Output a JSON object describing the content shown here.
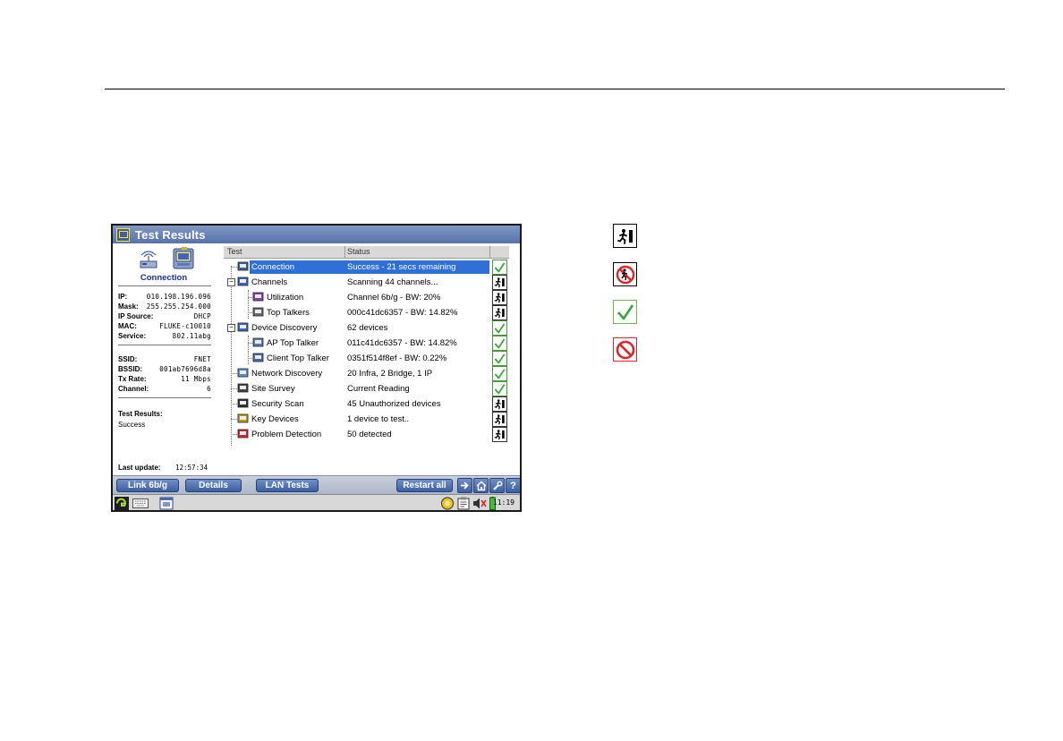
{
  "window": {
    "title": "Test Results"
  },
  "left_panel": {
    "connection_label": "Connection",
    "network_info": [
      {
        "key": "IP:",
        "value": "010.198.196.096"
      },
      {
        "key": "Mask:",
        "value": "255.255.254.000"
      },
      {
        "key": "IP Source:",
        "value": "DHCP"
      },
      {
        "key": "MAC:",
        "value": "FLUKE-c10010"
      },
      {
        "key": "Service:",
        "value": "802.11abg"
      }
    ],
    "wireless_info": [
      {
        "key": "SSID:",
        "value": "FNET"
      },
      {
        "key": "BSSID:",
        "value": "001ab7696d8a"
      },
      {
        "key": "Tx Rate:",
        "value": "11 Mbps"
      },
      {
        "key": "Channel:",
        "value": "6"
      }
    ],
    "test_results_label": "Test Results:",
    "test_results_value": "Success",
    "last_update_label": "Last update:",
    "last_update_value": "12:57:34"
  },
  "table": {
    "headers": {
      "test": "Test",
      "status": "Status"
    },
    "rows": [
      {
        "name": "Connection",
        "status": "Success - 21 secs remaining",
        "icon": "connection-icon",
        "indicator": "pass",
        "selected": true
      },
      {
        "name": "Channels",
        "status": "Scanning 44 channels...",
        "icon": "channels-icon",
        "indicator": "running"
      },
      {
        "name": "Utilization",
        "status": "Channel 6b/g - BW: 20%",
        "icon": "utilization-icon",
        "indicator": "running"
      },
      {
        "name": "Top Talkers",
        "status": "000c41dc6357 - BW: 14.82%",
        "icon": "top-talkers-icon",
        "indicator": "running"
      },
      {
        "name": "Device Discovery",
        "status": "62 devices",
        "icon": "device-discovery-icon",
        "indicator": "pass"
      },
      {
        "name": "AP Top Talker",
        "status": "011c41dc6357 - BW: 14.82%",
        "icon": "ap-icon",
        "indicator": "pass"
      },
      {
        "name": "Client Top Talker",
        "status": "0351f514f8ef - BW: 0.22%",
        "icon": "client-icon",
        "indicator": "pass"
      },
      {
        "name": "Network Discovery",
        "status": "20 Infra, 2 Bridge, 1 IP",
        "icon": "network-discovery-icon",
        "indicator": "pass"
      },
      {
        "name": "Site Survey",
        "status": "Current Reading",
        "icon": "site-survey-icon",
        "indicator": "pass"
      },
      {
        "name": "Security Scan",
        "status": "45 Unauthorized devices",
        "icon": "security-scan-icon",
        "indicator": "running"
      },
      {
        "name": "Key Devices",
        "status": "1 device to test..",
        "icon": "key-devices-icon",
        "indicator": "running"
      },
      {
        "name": "Problem Detection",
        "status": "50 detected",
        "icon": "problem-detection-icon",
        "indicator": "running"
      }
    ]
  },
  "buttons": {
    "link": "Link 6b/g",
    "details": "Details",
    "lan_tests": "LAN Tests",
    "restart_all": "Restart all",
    "help": "?"
  },
  "taskbar": {
    "clock": "11:19"
  },
  "legend": [
    {
      "icon": "test-running-icon"
    },
    {
      "icon": "test-stopped-icon"
    },
    {
      "icon": "test-passed-icon"
    },
    {
      "icon": "test-failed-icon"
    }
  ],
  "colors": {
    "titlebar": "#6a84b8",
    "selected_row": "#2f6fd8",
    "pass_green": "#3aa63a",
    "fail_red": "#d8262a",
    "link_blue": "#1a2f9a"
  }
}
